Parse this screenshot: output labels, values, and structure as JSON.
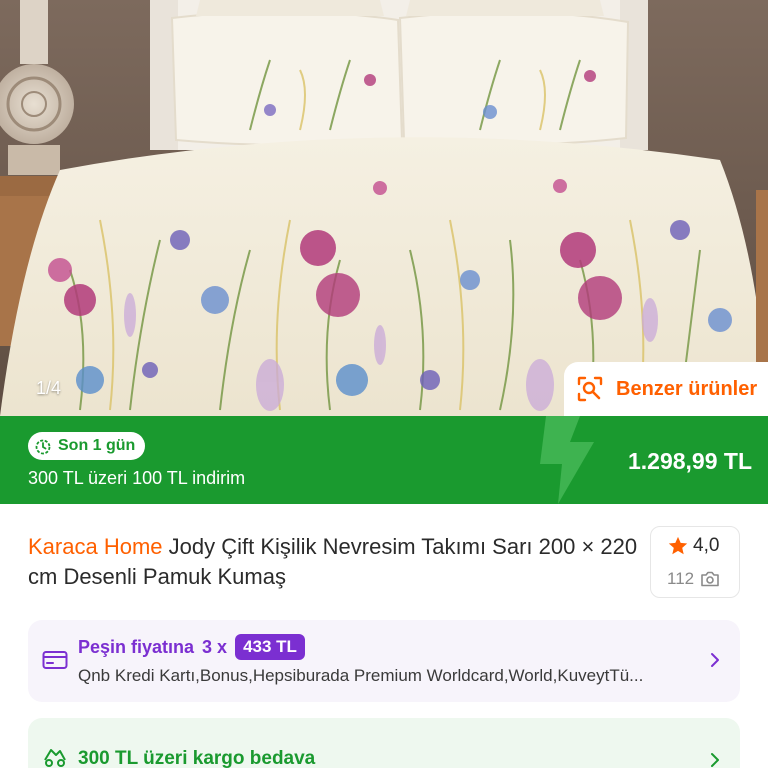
{
  "gallery": {
    "counter": "1/4",
    "similar_label": "Benzer ürünler"
  },
  "promo": {
    "timer_label": "Son 1 gün",
    "discount_text": "300 TL üzeri 100 TL indirim",
    "price": "1.298,99 TL"
  },
  "product": {
    "brand": "Karaca Home",
    "name": " Jody Çift Kişilik Nevresim Takımı Sarı 200 × 220 cm Desenli Pamuk Kumaş",
    "rating": "4,0",
    "review_count": "112"
  },
  "installment": {
    "label": "Peşin fiyatına",
    "multiplier": "3 x",
    "amount": "433 TL",
    "cards": "Qnb Kredi Kartı,Bonus,Hepsiburada Premium Worldcard,World,KuveytTü..."
  },
  "shipping": {
    "label": "300 TL üzeri kargo bedava"
  },
  "colors": {
    "brand_orange": "#ff6000",
    "promo_green": "#1a9a2f",
    "installment_purple": "#7b2fd1"
  },
  "icons": [
    "image-search-icon",
    "timer-icon",
    "star-icon",
    "camera-icon",
    "credit-card-icon",
    "chevron-right-icon",
    "truck-icon",
    "bolt-icon"
  ]
}
